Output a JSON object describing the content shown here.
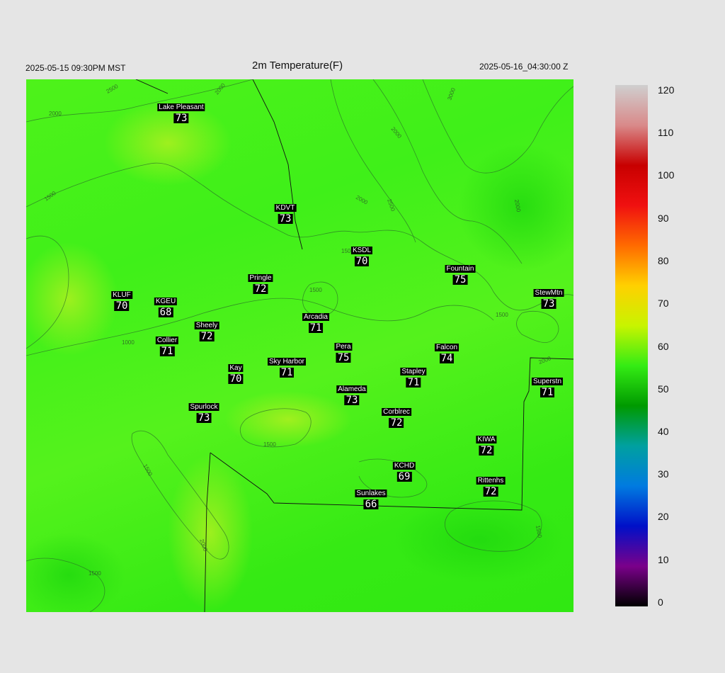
{
  "header": {
    "local_time": "2025-05-15 09:30PM MST",
    "title": "2m Temperature(F)",
    "utc_time": "2025-05-16_04:30:00 Z"
  },
  "stations": [
    {
      "name": "Lake Pleasant",
      "temp": "73"
    },
    {
      "name": "KDVT",
      "temp": "73"
    },
    {
      "name": "KSDL",
      "temp": "70"
    },
    {
      "name": "Fountain",
      "temp": "75"
    },
    {
      "name": "StewMtn",
      "temp": "73"
    },
    {
      "name": "Pringle",
      "temp": "72"
    },
    {
      "name": "KLUF",
      "temp": "70"
    },
    {
      "name": "KGEU",
      "temp": "68"
    },
    {
      "name": "Arcadia",
      "temp": "71"
    },
    {
      "name": "Sheely",
      "temp": "72"
    },
    {
      "name": "Collier",
      "temp": "71"
    },
    {
      "name": "Pera",
      "temp": "75"
    },
    {
      "name": "Falcon",
      "temp": "74"
    },
    {
      "name": "Kay",
      "temp": "70"
    },
    {
      "name": "Sky Harbor",
      "temp": "71"
    },
    {
      "name": "Stapley",
      "temp": "71"
    },
    {
      "name": "Superstn",
      "temp": "71"
    },
    {
      "name": "Alameda",
      "temp": "73"
    },
    {
      "name": "Spurlock",
      "temp": "73"
    },
    {
      "name": "Corblrec",
      "temp": "72"
    },
    {
      "name": "KIWA",
      "temp": "72"
    },
    {
      "name": "KCHD",
      "temp": "69"
    },
    {
      "name": "Rittenhs",
      "temp": "72"
    },
    {
      "name": "Sunlakes",
      "temp": "66"
    }
  ],
  "contour_labels": [
    "2500",
    "2000",
    "2000",
    "3000",
    "1500",
    "2000",
    "2500",
    "2000",
    "2000",
    "1500",
    "1500",
    "1500",
    "1000",
    "1500",
    "1500",
    "2000",
    "1500",
    "1500",
    "2000"
  ],
  "colorbar": {
    "ticks": [
      "120",
      "110",
      "100",
      "90",
      "80",
      "70",
      "60",
      "50",
      "40",
      "30",
      "20",
      "10",
      "0"
    ],
    "colors": [
      "#cfcfcf",
      "#d98a8a",
      "#c80000",
      "#f01010",
      "#ff6a00",
      "#ffd000",
      "#c8f400",
      "#34ec14",
      "#009a00",
      "#00a0a0",
      "#007be0",
      "#0010c8",
      "#7a008a",
      "#000000"
    ]
  }
}
